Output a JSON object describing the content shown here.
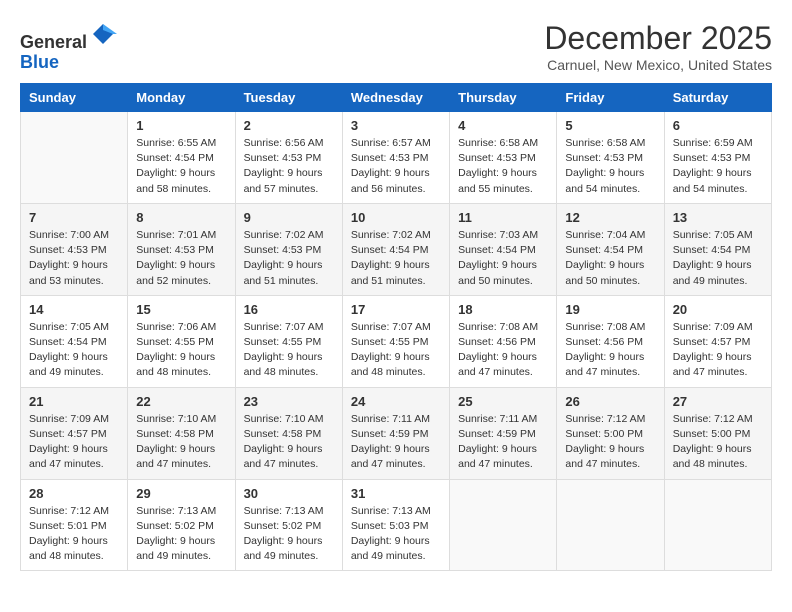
{
  "logo": {
    "general": "General",
    "blue": "Blue"
  },
  "header": {
    "month": "December 2025",
    "location": "Carnuel, New Mexico, United States"
  },
  "weekdays": [
    "Sunday",
    "Monday",
    "Tuesday",
    "Wednesday",
    "Thursday",
    "Friday",
    "Saturday"
  ],
  "weeks": [
    [
      {
        "day": "",
        "sunrise": "",
        "sunset": "",
        "daylight": ""
      },
      {
        "day": "1",
        "sunrise": "Sunrise: 6:55 AM",
        "sunset": "Sunset: 4:54 PM",
        "daylight": "Daylight: 9 hours and 58 minutes."
      },
      {
        "day": "2",
        "sunrise": "Sunrise: 6:56 AM",
        "sunset": "Sunset: 4:53 PM",
        "daylight": "Daylight: 9 hours and 57 minutes."
      },
      {
        "day": "3",
        "sunrise": "Sunrise: 6:57 AM",
        "sunset": "Sunset: 4:53 PM",
        "daylight": "Daylight: 9 hours and 56 minutes."
      },
      {
        "day": "4",
        "sunrise": "Sunrise: 6:58 AM",
        "sunset": "Sunset: 4:53 PM",
        "daylight": "Daylight: 9 hours and 55 minutes."
      },
      {
        "day": "5",
        "sunrise": "Sunrise: 6:58 AM",
        "sunset": "Sunset: 4:53 PM",
        "daylight": "Daylight: 9 hours and 54 minutes."
      },
      {
        "day": "6",
        "sunrise": "Sunrise: 6:59 AM",
        "sunset": "Sunset: 4:53 PM",
        "daylight": "Daylight: 9 hours and 54 minutes."
      }
    ],
    [
      {
        "day": "7",
        "sunrise": "Sunrise: 7:00 AM",
        "sunset": "Sunset: 4:53 PM",
        "daylight": "Daylight: 9 hours and 53 minutes."
      },
      {
        "day": "8",
        "sunrise": "Sunrise: 7:01 AM",
        "sunset": "Sunset: 4:53 PM",
        "daylight": "Daylight: 9 hours and 52 minutes."
      },
      {
        "day": "9",
        "sunrise": "Sunrise: 7:02 AM",
        "sunset": "Sunset: 4:53 PM",
        "daylight": "Daylight: 9 hours and 51 minutes."
      },
      {
        "day": "10",
        "sunrise": "Sunrise: 7:02 AM",
        "sunset": "Sunset: 4:54 PM",
        "daylight": "Daylight: 9 hours and 51 minutes."
      },
      {
        "day": "11",
        "sunrise": "Sunrise: 7:03 AM",
        "sunset": "Sunset: 4:54 PM",
        "daylight": "Daylight: 9 hours and 50 minutes."
      },
      {
        "day": "12",
        "sunrise": "Sunrise: 7:04 AM",
        "sunset": "Sunset: 4:54 PM",
        "daylight": "Daylight: 9 hours and 50 minutes."
      },
      {
        "day": "13",
        "sunrise": "Sunrise: 7:05 AM",
        "sunset": "Sunset: 4:54 PM",
        "daylight": "Daylight: 9 hours and 49 minutes."
      }
    ],
    [
      {
        "day": "14",
        "sunrise": "Sunrise: 7:05 AM",
        "sunset": "Sunset: 4:54 PM",
        "daylight": "Daylight: 9 hours and 49 minutes."
      },
      {
        "day": "15",
        "sunrise": "Sunrise: 7:06 AM",
        "sunset": "Sunset: 4:55 PM",
        "daylight": "Daylight: 9 hours and 48 minutes."
      },
      {
        "day": "16",
        "sunrise": "Sunrise: 7:07 AM",
        "sunset": "Sunset: 4:55 PM",
        "daylight": "Daylight: 9 hours and 48 minutes."
      },
      {
        "day": "17",
        "sunrise": "Sunrise: 7:07 AM",
        "sunset": "Sunset: 4:55 PM",
        "daylight": "Daylight: 9 hours and 48 minutes."
      },
      {
        "day": "18",
        "sunrise": "Sunrise: 7:08 AM",
        "sunset": "Sunset: 4:56 PM",
        "daylight": "Daylight: 9 hours and 47 minutes."
      },
      {
        "day": "19",
        "sunrise": "Sunrise: 7:08 AM",
        "sunset": "Sunset: 4:56 PM",
        "daylight": "Daylight: 9 hours and 47 minutes."
      },
      {
        "day": "20",
        "sunrise": "Sunrise: 7:09 AM",
        "sunset": "Sunset: 4:57 PM",
        "daylight": "Daylight: 9 hours and 47 minutes."
      }
    ],
    [
      {
        "day": "21",
        "sunrise": "Sunrise: 7:09 AM",
        "sunset": "Sunset: 4:57 PM",
        "daylight": "Daylight: 9 hours and 47 minutes."
      },
      {
        "day": "22",
        "sunrise": "Sunrise: 7:10 AM",
        "sunset": "Sunset: 4:58 PM",
        "daylight": "Daylight: 9 hours and 47 minutes."
      },
      {
        "day": "23",
        "sunrise": "Sunrise: 7:10 AM",
        "sunset": "Sunset: 4:58 PM",
        "daylight": "Daylight: 9 hours and 47 minutes."
      },
      {
        "day": "24",
        "sunrise": "Sunrise: 7:11 AM",
        "sunset": "Sunset: 4:59 PM",
        "daylight": "Daylight: 9 hours and 47 minutes."
      },
      {
        "day": "25",
        "sunrise": "Sunrise: 7:11 AM",
        "sunset": "Sunset: 4:59 PM",
        "daylight": "Daylight: 9 hours and 47 minutes."
      },
      {
        "day": "26",
        "sunrise": "Sunrise: 7:12 AM",
        "sunset": "Sunset: 5:00 PM",
        "daylight": "Daylight: 9 hours and 47 minutes."
      },
      {
        "day": "27",
        "sunrise": "Sunrise: 7:12 AM",
        "sunset": "Sunset: 5:00 PM",
        "daylight": "Daylight: 9 hours and 48 minutes."
      }
    ],
    [
      {
        "day": "28",
        "sunrise": "Sunrise: 7:12 AM",
        "sunset": "Sunset: 5:01 PM",
        "daylight": "Daylight: 9 hours and 48 minutes."
      },
      {
        "day": "29",
        "sunrise": "Sunrise: 7:13 AM",
        "sunset": "Sunset: 5:02 PM",
        "daylight": "Daylight: 9 hours and 49 minutes."
      },
      {
        "day": "30",
        "sunrise": "Sunrise: 7:13 AM",
        "sunset": "Sunset: 5:02 PM",
        "daylight": "Daylight: 9 hours and 49 minutes."
      },
      {
        "day": "31",
        "sunrise": "Sunrise: 7:13 AM",
        "sunset": "Sunset: 5:03 PM",
        "daylight": "Daylight: 9 hours and 49 minutes."
      },
      {
        "day": "",
        "sunrise": "",
        "sunset": "",
        "daylight": ""
      },
      {
        "day": "",
        "sunrise": "",
        "sunset": "",
        "daylight": ""
      },
      {
        "day": "",
        "sunrise": "",
        "sunset": "",
        "daylight": ""
      }
    ]
  ]
}
